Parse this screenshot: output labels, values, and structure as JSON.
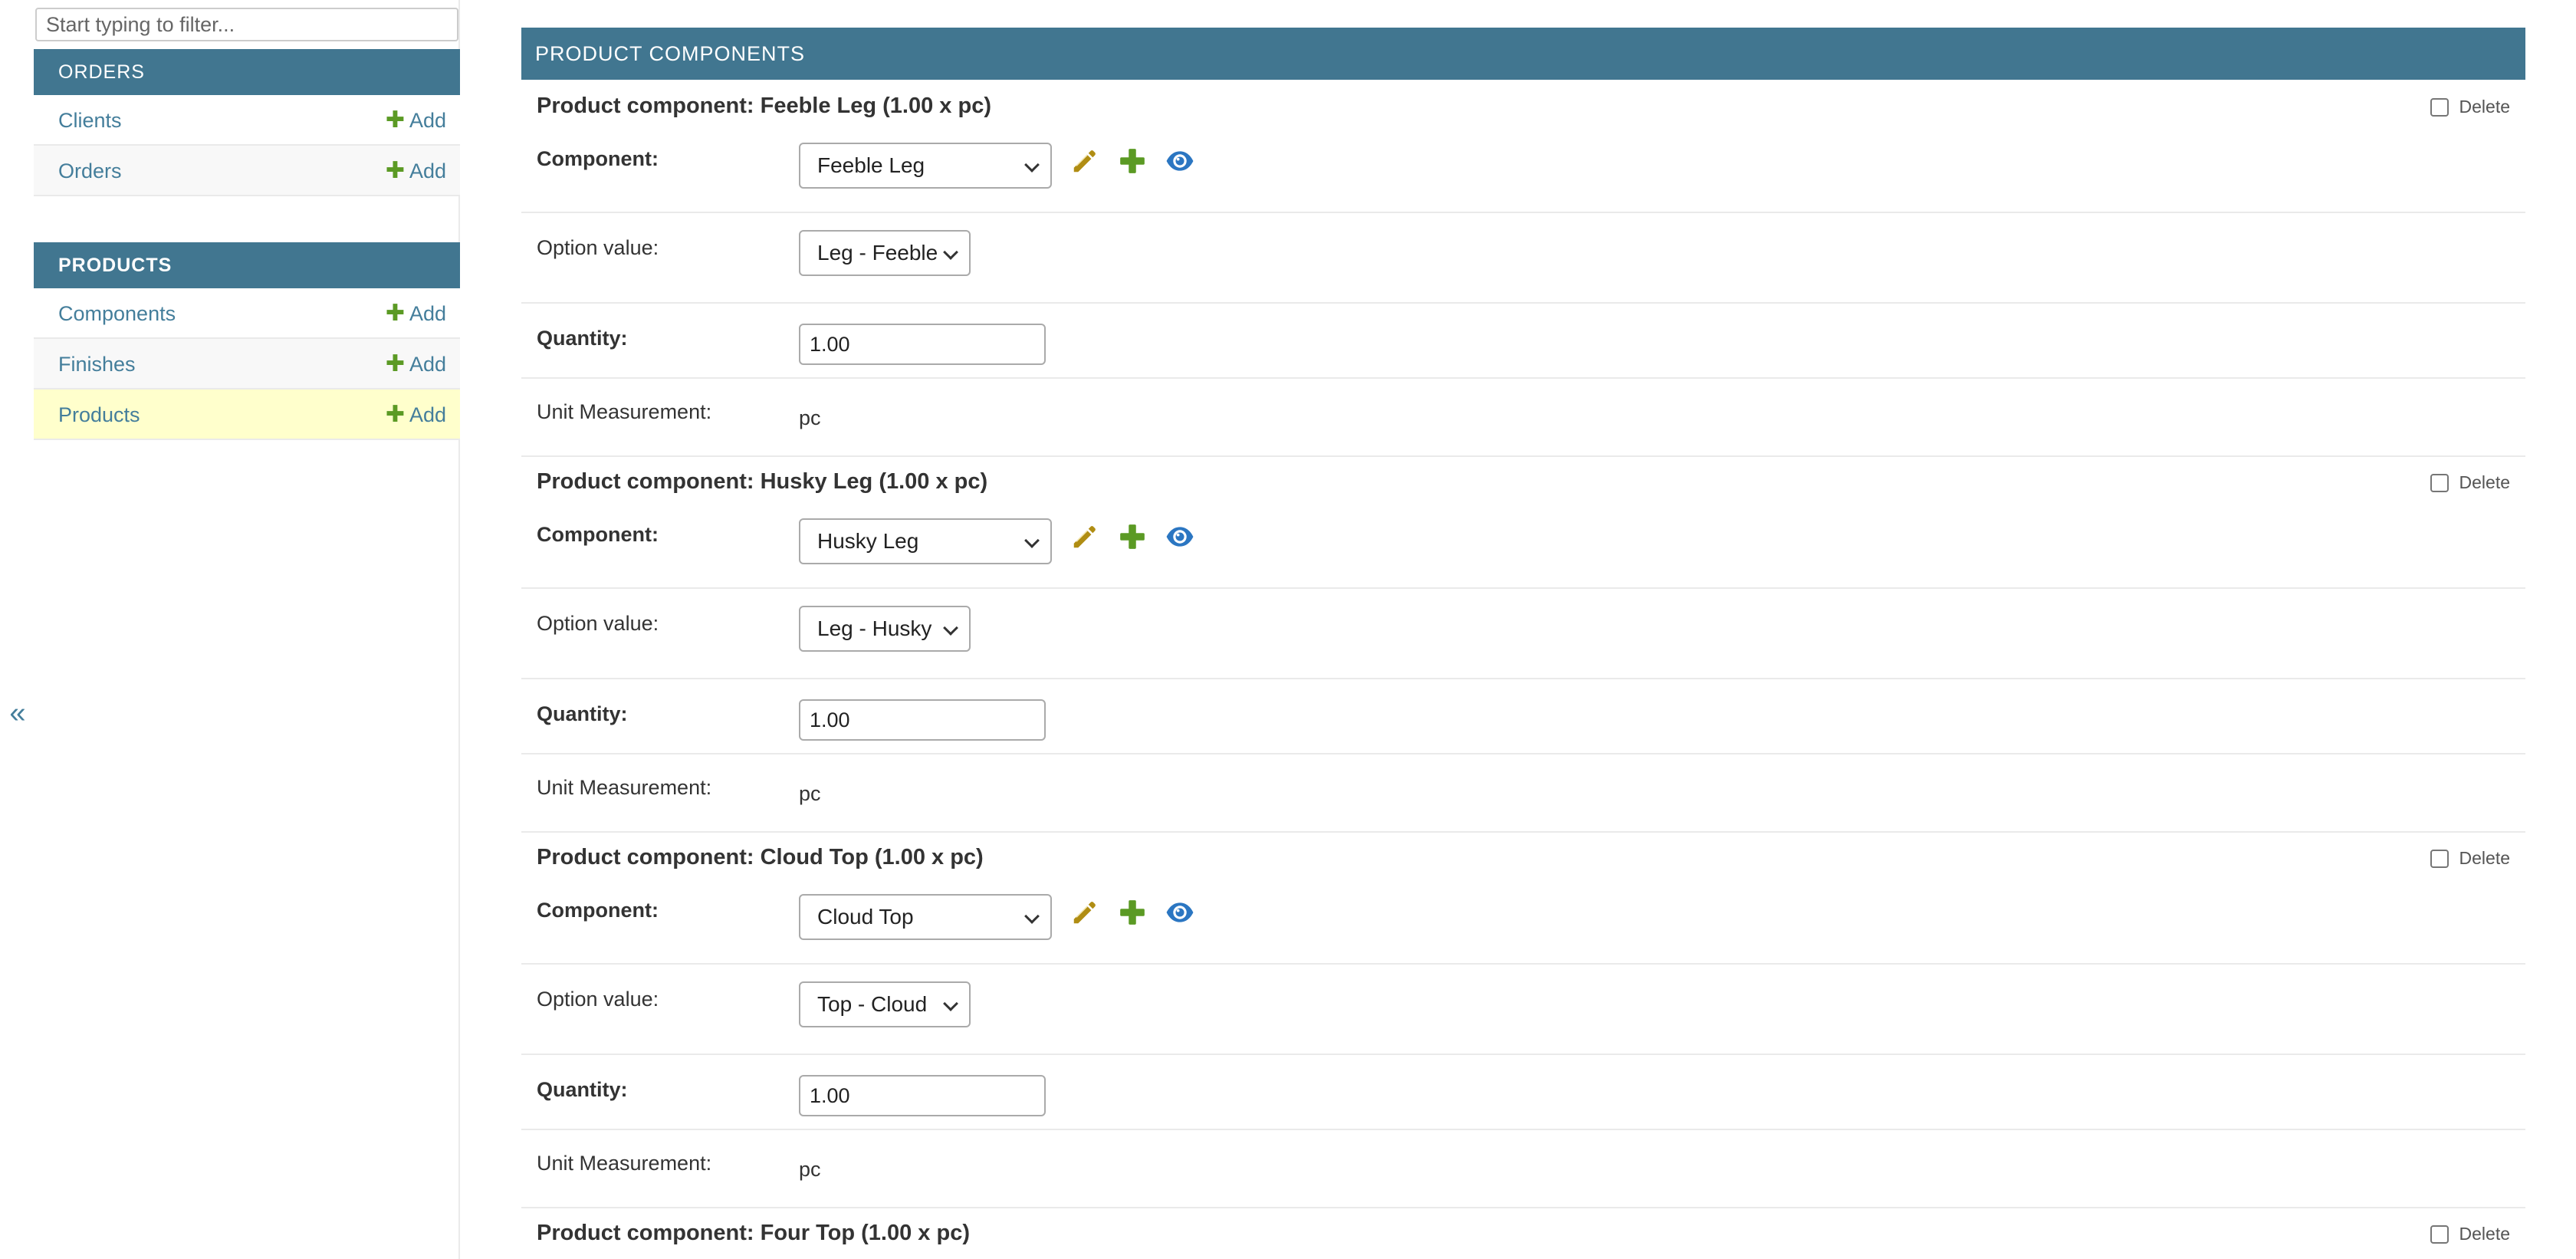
{
  "sidebar": {
    "filter_placeholder": "Start typing to filter...",
    "collapse_label": "«",
    "orders_module": {
      "caption": "ORDERS",
      "items": [
        {
          "label": "Clients",
          "add": "Add"
        },
        {
          "label": "Orders",
          "add": "Add"
        }
      ]
    },
    "products_module": {
      "caption": "PRODUCTS",
      "items": [
        {
          "label": "Components",
          "add": "Add"
        },
        {
          "label": "Finishes",
          "add": "Add"
        },
        {
          "label": "Products",
          "add": "Add",
          "selected": true
        }
      ]
    }
  },
  "main": {
    "section_title": "PRODUCT COMPONENTS",
    "labels": {
      "component": "Component:",
      "option_value": "Option value:",
      "quantity": "Quantity:",
      "unit_measurement": "Unit Measurement:",
      "delete": "Delete"
    },
    "components": [
      {
        "title": "Product component: Feeble Leg (1.00 x pc)",
        "component": "Feeble Leg",
        "option_value": "Leg - Feeble",
        "quantity": "1.00",
        "unit": "pc"
      },
      {
        "title": "Product component: Husky Leg (1.00 x pc)",
        "component": "Husky Leg",
        "option_value": "Leg - Husky",
        "quantity": "1.00",
        "unit": "pc"
      },
      {
        "title": "Product component: Cloud Top (1.00 x pc)",
        "component": "Cloud Top",
        "option_value": "Top - Cloud",
        "quantity": "1.00",
        "unit": "pc"
      },
      {
        "title": "Product component: Four Top (1.00 x pc)"
      }
    ]
  },
  "icons": {
    "edit": "pencil-icon",
    "add": "plus-icon",
    "view": "eye-icon",
    "colors": {
      "pencil": "#b08d13",
      "plus": "#5b9a24",
      "eye": "#2b76c2"
    }
  }
}
